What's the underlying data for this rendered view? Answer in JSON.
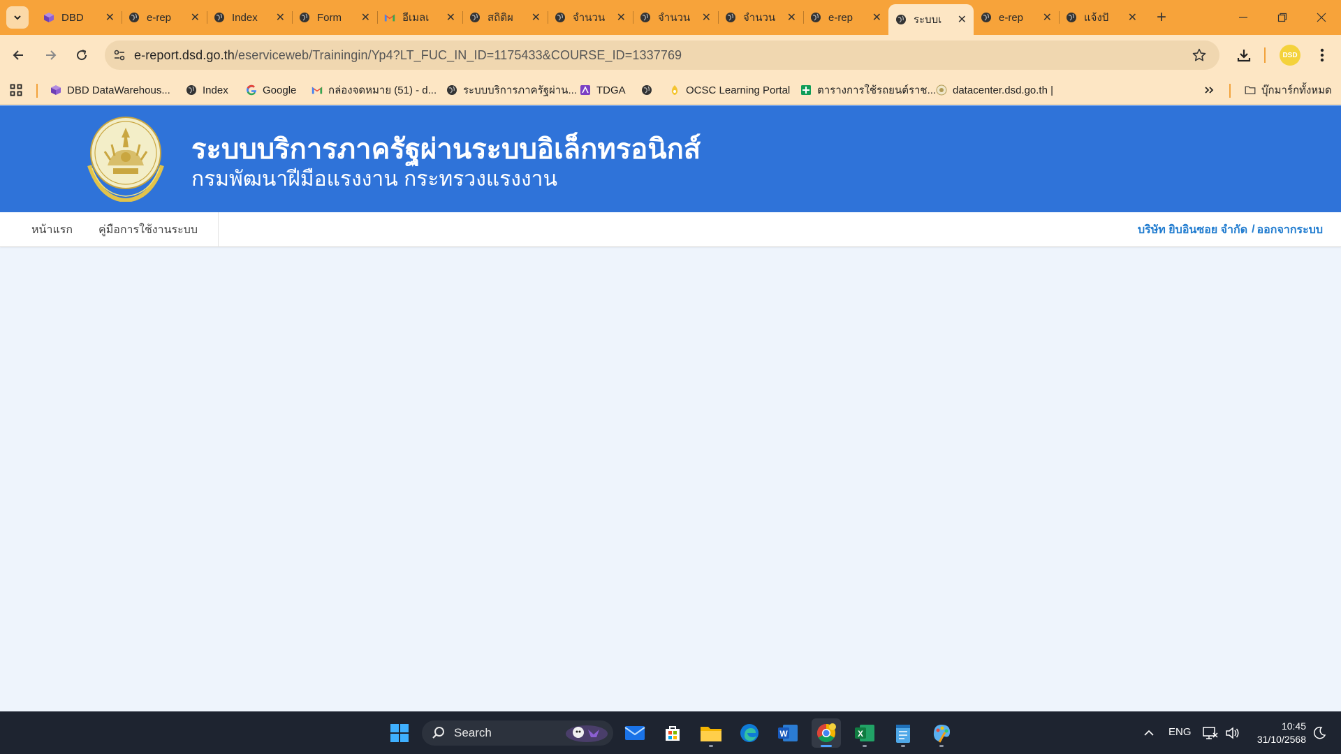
{
  "browser": {
    "tabs": [
      {
        "title": "DBD",
        "icon": "dbd-cube-icon"
      },
      {
        "title": "e-rep",
        "icon": "globe-icon"
      },
      {
        "title": "Index",
        "icon": "globe-icon"
      },
      {
        "title": "Form",
        "icon": "globe-icon"
      },
      {
        "title": "อีเมลเ",
        "icon": "gmail-icon"
      },
      {
        "title": "สถิติผ",
        "icon": "globe-icon"
      },
      {
        "title": "จำนวน",
        "icon": "globe-icon"
      },
      {
        "title": "จำนวน",
        "icon": "globe-icon"
      },
      {
        "title": "จำนวน",
        "icon": "globe-icon"
      },
      {
        "title": "e-rep",
        "icon": "globe-icon"
      },
      {
        "title": "ระบบเ",
        "icon": "globe-icon",
        "active": true
      },
      {
        "title": "e-rep",
        "icon": "globe-icon"
      },
      {
        "title": "แจ้งปั",
        "icon": "globe-icon"
      }
    ],
    "url_host": "e-report.dsd.go.th",
    "url_path": "/eserviceweb/Trainingin/Yp4?LT_FUC_IN_ID=1175433&COURSE_ID=1337769",
    "profile_label": "DSD",
    "bookmarks": [
      {
        "label": "DBD DataWarehous...",
        "icon": "dbd-cube-icon"
      },
      {
        "label": "Index",
        "icon": "globe-icon"
      },
      {
        "label": "Google",
        "icon": "google-icon"
      },
      {
        "label": "กล่องจดหมาย (51) - d...",
        "icon": "gmail-icon"
      },
      {
        "label": "ระบบบริการภาครัฐผ่าน...",
        "icon": "globe-icon"
      },
      {
        "label": "TDGA",
        "icon": "tdga-icon"
      },
      {
        "label": "",
        "icon": "globe-icon"
      },
      {
        "label": "OCSC Learning Portal",
        "icon": "ocsc-icon"
      },
      {
        "label": "ตารางการใช้รถยนต์ราช...",
        "icon": "sheets-icon"
      },
      {
        "label": "datacenter.dsd.go.th |",
        "icon": "datacenter-icon"
      }
    ],
    "all_bookmarks_label": "บุ๊กมาร์กทั้งหมด"
  },
  "site": {
    "title": "ระบบบริการภาครัฐผ่านระบบอิเล็กทรอนิกส์",
    "subtitle": "กรมพัฒนาฝีมือแรงงาน กระทรวงแรงงาน",
    "nav": {
      "home": "หน้าแรก",
      "manual": "คู่มือการใช้งานระบบ"
    },
    "user_company": "บริษัท ยิบอินซอย จำกัด",
    "user_separator": "/",
    "logout": "ออกจากระบบ",
    "colors": {
      "banner": "#2f73d9",
      "link": "#1f7bcf",
      "background": "#eef4fc"
    }
  },
  "taskbar": {
    "search_placeholder": "Search",
    "language": "ENG",
    "time": "10:45",
    "date": "31/10/2568",
    "apps": [
      "windows-start-icon",
      "mail-icon",
      "store-icon",
      "file-explorer-icon",
      "edge-icon",
      "word-icon",
      "chrome-icon",
      "excel-icon",
      "notepad-icon",
      "paint-icon"
    ]
  }
}
